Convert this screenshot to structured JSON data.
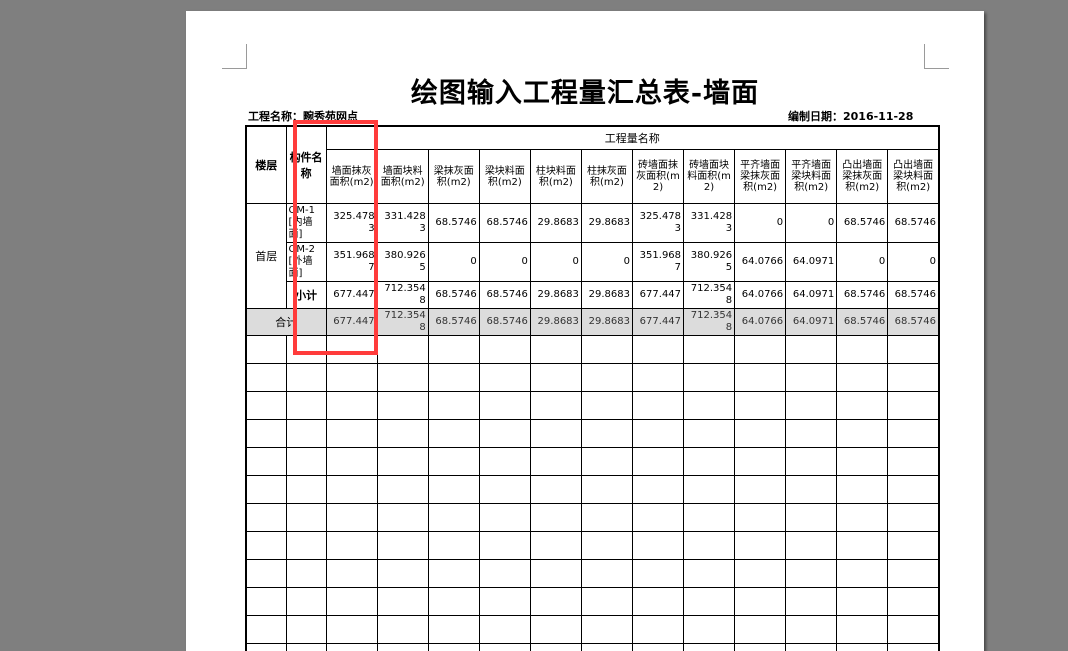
{
  "title": "绘图输入工程量汇总表-墙面",
  "project": "工程名称：畹秀苑网点",
  "edit_date": "编制日期：2016-11-28",
  "table": {
    "floor_header": "楼层",
    "component_header": "构件名称",
    "group_header": "工程量名称",
    "columns": [
      "墙面抹灰面积(m2)",
      "墙面块料面积(m2)",
      "梁抹灰面积(m2)",
      "梁块料面积(m2)",
      "柱块料面积(m2)",
      "柱抹灰面积(m2)",
      "砖墙面抹灰面积(m2)",
      "砖墙面块料面积(m2)",
      "平齐墙面梁抹灰面积(m2)",
      "平齐墙面梁块料面积(m2)",
      "凸出墙面梁抹灰面积(m2)",
      "凸出墙面梁块料面积(m2)"
    ],
    "floor": "首层",
    "items": [
      {
        "name": "QM-1[内墙面]",
        "values": [
          "325.4783",
          "331.4283",
          "68.5746",
          "68.5746",
          "29.8683",
          "29.8683",
          "325.4783",
          "331.4283",
          "0",
          "0",
          "68.5746",
          "68.5746"
        ]
      },
      {
        "name": "QM-2[外墙面]",
        "values": [
          "351.9687",
          "380.9265",
          "0",
          "0",
          "0",
          "0",
          "351.9687",
          "380.9265",
          "64.0766",
          "64.0971",
          "0",
          "0"
        ]
      }
    ],
    "subtotal": {
      "label": "小计",
      "values": [
        "677.447",
        "712.3548",
        "68.5746",
        "68.5746",
        "29.8683",
        "29.8683",
        "677.447",
        "712.3548",
        "64.0766",
        "64.0971",
        "68.5746",
        "68.5746"
      ]
    },
    "total": {
      "label": "合计",
      "values": [
        "677.447",
        "712.3548",
        "68.5746",
        "68.5746",
        "29.8683",
        "29.8683",
        "677.447",
        "712.3548",
        "64.0766",
        "64.0971",
        "68.5746",
        "68.5746"
      ]
    }
  },
  "colors": {
    "highlight": "#ff3b3b",
    "total_row": "#dcdcdc",
    "background": "#7f7f7f"
  }
}
